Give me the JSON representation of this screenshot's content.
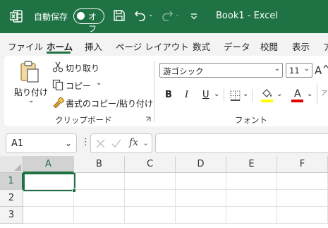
{
  "titlebar": {
    "autosave_label": "自動保存",
    "autosave_state": "オフ",
    "title": "Book1  -  Excel",
    "background": "#1f7244"
  },
  "menu": {
    "tabs": [
      "ファイル",
      "ホーム",
      "挿入",
      "ページ レイアウト",
      "数式",
      "データ",
      "校閲",
      "表示",
      "ア"
    ],
    "active_tab": "ホーム"
  },
  "clipboard": {
    "paste_label": "貼り付け",
    "cut_label": "切り取り",
    "copy_label": "コピー",
    "format_painter_label": "書式のコピー/貼り付け",
    "group_label": "クリップボード"
  },
  "font": {
    "font_name": "游ゴシック",
    "font_size": "11",
    "bold": "B",
    "italic": "I",
    "underline": "U",
    "font_color_letter": "A",
    "group_label": "フォント",
    "fill_color": "#ffff00",
    "font_color": "#e00000",
    "clipped_text": "ア"
  },
  "formula_bar": {
    "name_box": "A1",
    "dots": "⋮",
    "fx": "fx",
    "value": ""
  },
  "grid": {
    "columns": [
      "A",
      "B",
      "C",
      "D",
      "E",
      "F"
    ],
    "rows": [
      "1",
      "2",
      "3"
    ],
    "active_cell": "A1"
  }
}
